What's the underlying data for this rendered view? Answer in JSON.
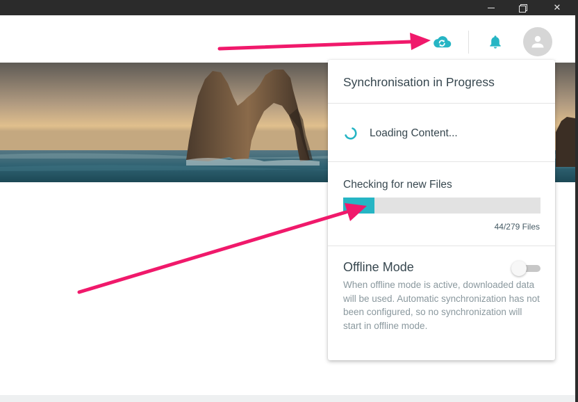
{
  "window": {
    "minimize_glyph": "",
    "close_glyph": "✕"
  },
  "header": {
    "sync_icon": "cloud-sync-icon",
    "notifications_icon": "bell-icon",
    "avatar_icon": "user-avatar-icon"
  },
  "banner": {
    "image": "sea-rock-arch-sunset"
  },
  "sync_panel": {
    "title": "Synchronisation in Progress",
    "loading_label": "Loading Content...",
    "checking_label": "Checking for new Files",
    "progress": {
      "done": 44,
      "total": 279,
      "fill_fraction": 0.157
    },
    "progress_label": "44/279 Files",
    "offline_mode": {
      "title": "Offline Mode",
      "enabled": false,
      "description": "When offline mode is active, downloaded data will be used. Automatic synchronization has not been configured, so no synchronization will start in offline mode."
    }
  },
  "colors": {
    "accent": "#26b5c4",
    "annotation_arrow": "#f0196b",
    "title_bar": "#2b2b2b"
  }
}
